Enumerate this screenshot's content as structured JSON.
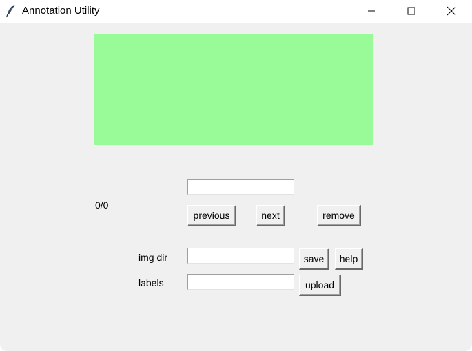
{
  "window": {
    "title": "Annotation Utility",
    "icon": "feather-icon",
    "controls": [
      "minimize-icon",
      "maximize-icon",
      "close-icon"
    ]
  },
  "canvas": {
    "background": "#98fb98"
  },
  "counter": "0/0",
  "label_entry": {
    "value": "",
    "placeholder": ""
  },
  "nav": {
    "previous_label": "previous",
    "next_label": "next",
    "remove_label": "remove"
  },
  "img_dir": {
    "label": "img dir",
    "value": ""
  },
  "labels": {
    "label": "labels",
    "value": ""
  },
  "actions": {
    "save_label": "save",
    "help_label": "help",
    "upload_label": "upload"
  }
}
